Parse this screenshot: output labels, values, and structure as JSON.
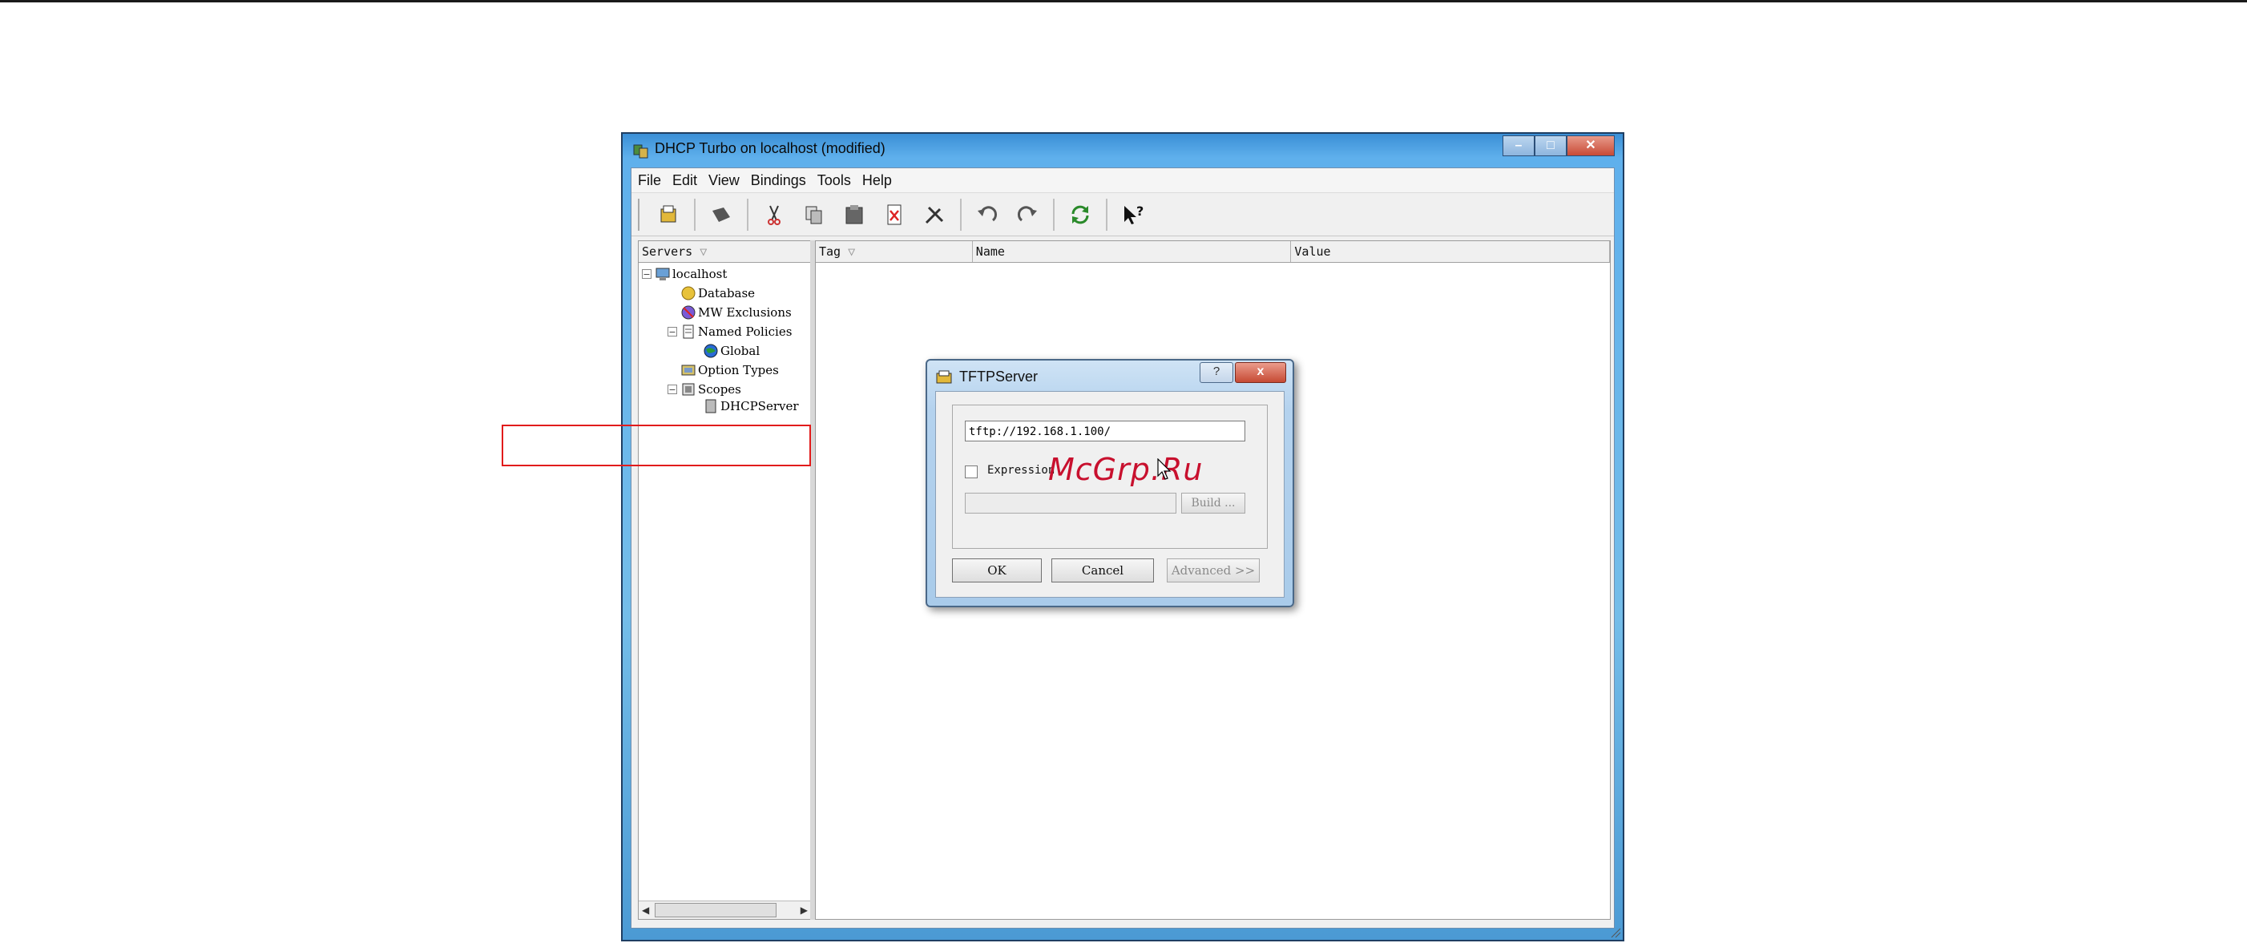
{
  "window": {
    "title": "DHCP Turbo on localhost (modified)",
    "controls": [
      "minimize",
      "maximize",
      "close"
    ]
  },
  "menu": [
    "File",
    "Edit",
    "View",
    "Bindings",
    "Tools",
    "Help"
  ],
  "toolbar": {
    "icons": [
      "new-icon",
      "delete-icon",
      "cut-icon",
      "copy-icon",
      "paste-icon",
      "remove-icon",
      "tools-icon",
      "undo-icon",
      "redo-icon",
      "refresh-icon",
      "help-pointer-icon"
    ]
  },
  "tree": {
    "header": "Servers",
    "nodes": [
      "localhost",
      "Database",
      "MW Exclusions",
      "Named Policies",
      "Global",
      "Option Types",
      "Scopes",
      "DHCPServer"
    ]
  },
  "grid": {
    "columns": [
      "Tag",
      "Name",
      "Value"
    ]
  },
  "dialog": {
    "title": "TFTPServer",
    "help": "?",
    "close": "x",
    "value": "tftp://192.168.1.100/",
    "expression_label": "Expression",
    "build_label": "Build ...",
    "ok_label": "OK",
    "cancel_label": "Cancel",
    "advanced_label": "Advanced >>"
  },
  "watermark": "McGrp.Ru",
  "colors": {
    "highlight_box": "#e11b1b",
    "title_gradient": "#5fb0ec",
    "watermark": "#c8102e"
  }
}
